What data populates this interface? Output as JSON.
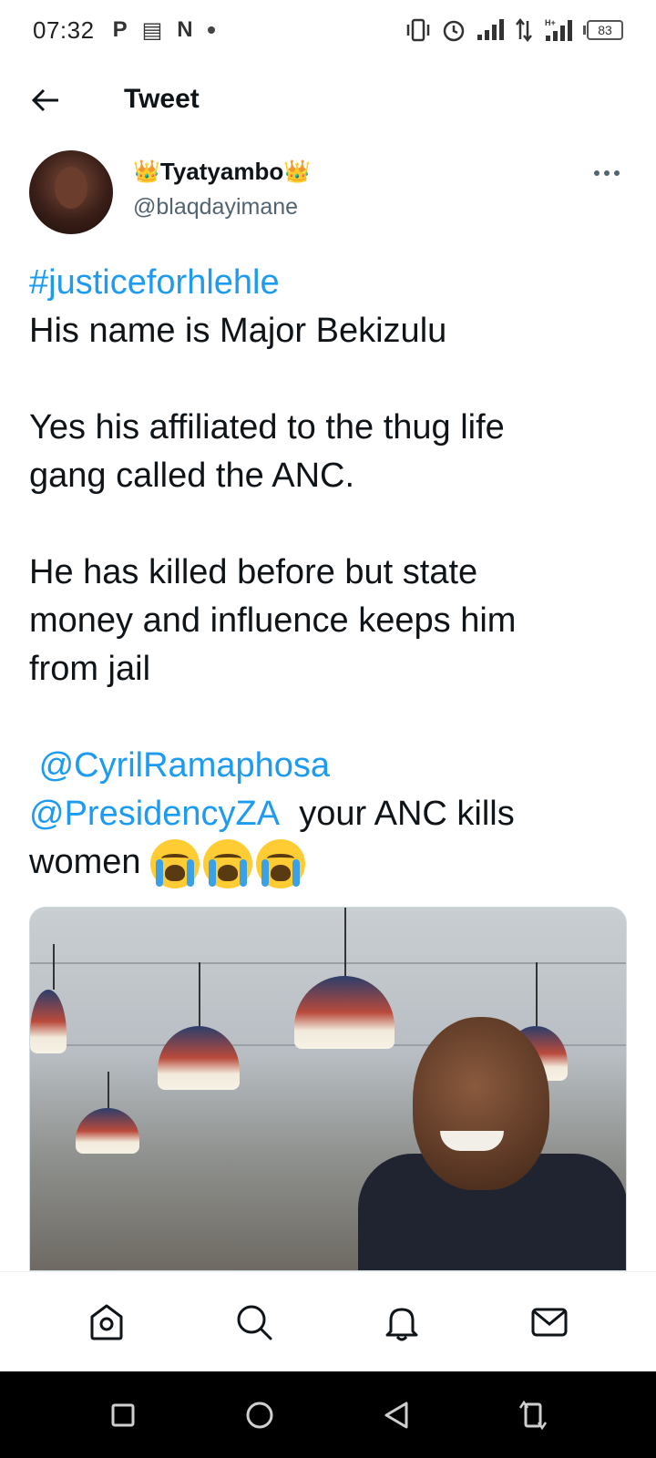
{
  "status_bar": {
    "time": "07:32",
    "left_glyphs": [
      "P",
      "▤",
      "N"
    ],
    "battery_level": "83"
  },
  "header": {
    "title": "Tweet"
  },
  "tweet": {
    "author": {
      "display_name": "Tyatyambo",
      "name_emoji_left": "👑",
      "name_emoji_right": "👑",
      "handle": "@blaqdayimane"
    },
    "text": {
      "hashtag": "#justiceforhlehle",
      "line1": "His name is Major Bekizulu",
      "line2": "Yes his affiliated to the thug life",
      "line3": "gang called the ANC.",
      "line4": "He has killed before but state",
      "line5": "money and influence keeps him",
      "line6": "from jail",
      "mention1": "@CyrilRamaphosa",
      "mention2": "@PresidencyZA",
      "line7_rest": "your ANC kills",
      "line8": "women"
    },
    "emoji_count": 3
  },
  "bottom_nav": {
    "items": [
      "home-icon",
      "search-icon",
      "notifications-icon",
      "messages-icon"
    ]
  },
  "system_nav": {
    "items": [
      "recents-icon",
      "home-circle-icon",
      "back-triangle-icon",
      "rotate-icon"
    ]
  },
  "colors": {
    "link": "#1d9bf0",
    "text": "#0f1419",
    "secondary": "#536471"
  }
}
